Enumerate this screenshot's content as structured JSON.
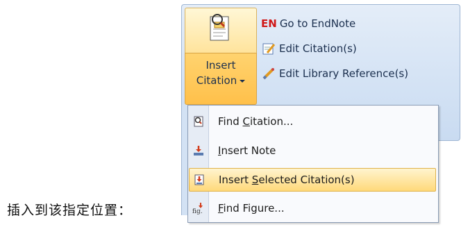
{
  "ribbon": {
    "insert_citation": {
      "line1": "Insert",
      "line2": "Citation"
    },
    "items": [
      {
        "badge": "EN",
        "label": "Go to EndNote"
      },
      {
        "label": "Edit Citation(s)"
      },
      {
        "label": "Edit Library Reference(s)"
      }
    ]
  },
  "menu": {
    "items": [
      {
        "before": "Find ",
        "mnemonic": "C",
        "after": "itation...",
        "icon": "find-citation-icon"
      },
      {
        "before": "",
        "mnemonic": "I",
        "after": "nsert Note",
        "icon": "insert-note-icon"
      },
      {
        "before": "Insert ",
        "mnemonic": "S",
        "after": "elected Citation(s)",
        "icon": "insert-selected-citation-icon",
        "selected": true
      },
      {
        "before": "",
        "mnemonic": "F",
        "after": "ind Figure...",
        "icon": "find-figure-icon"
      }
    ]
  },
  "caption": "插入到该指定位置：",
  "colors": {
    "highlight": "#ffd97a",
    "ribbon": "#d6e4f5",
    "en_red": "#d01818"
  }
}
